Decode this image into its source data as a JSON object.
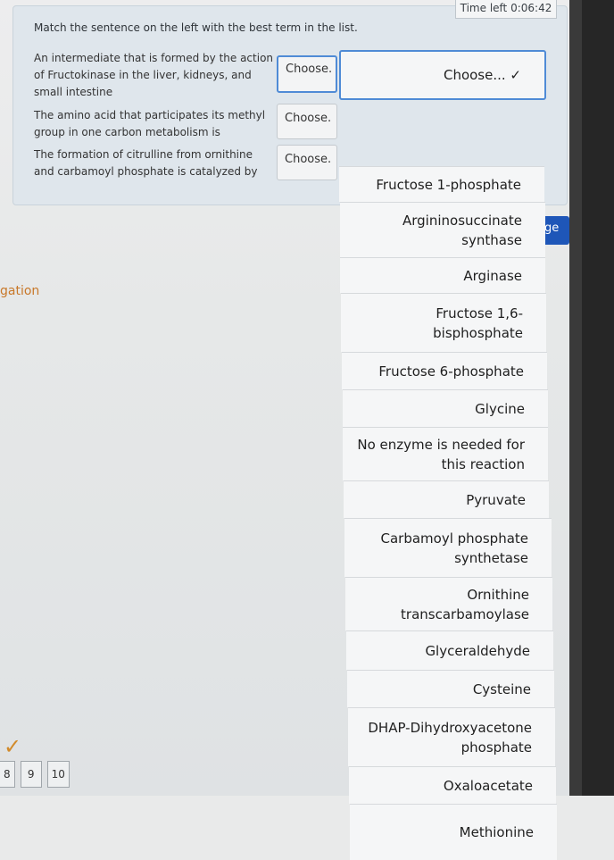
{
  "timer": "Time left 0:06:42",
  "instruction": "Match the sentence on the left with the best term in the list.",
  "questions": [
    {
      "prompt": "An intermediate that is formed by the action of Fructokinase in the liver, kidneys, and small intestine",
      "choice": "Choose."
    },
    {
      "prompt": "The amino acid that participates its methyl group in one carbon metabolism is",
      "choice": "Choose."
    },
    {
      "prompt": "The formation of citrulline from ornithine and carbamoyl phosphate is catalyzed by",
      "choice": "Choose."
    }
  ],
  "dropdown_options": [
    [
      "Choose... ✓"
    ],
    [
      "Fructose 1-phosphate"
    ],
    [
      "Argininosuccinate",
      "synthase"
    ],
    [
      "Arginase"
    ],
    [
      "Fructose 1,6-",
      "bisphosphate"
    ],
    [
      "Fructose 6-phosphate"
    ],
    [
      "Glycine"
    ],
    [
      "No enzyme is needed for",
      "this reaction"
    ],
    [
      "Pyruvate"
    ],
    [
      "Carbamoyl phosphate",
      "synthetase"
    ],
    [
      "Ornithine",
      "transcarbamoylase"
    ],
    [
      "Glyceraldehyde"
    ],
    [
      "Cysteine"
    ],
    [
      "DHAP-Dihydroxyacetone",
      "phosphate"
    ],
    [
      "Oxaloacetate"
    ],
    [
      "Methionine"
    ]
  ],
  "side_tab": "ge",
  "nav_label": "gation",
  "page_numbers": [
    "8",
    "9",
    "10"
  ],
  "colors": {
    "accent": "#4f8bd6",
    "side_tab": "#1e56b8",
    "nav_label": "#c8782a"
  }
}
